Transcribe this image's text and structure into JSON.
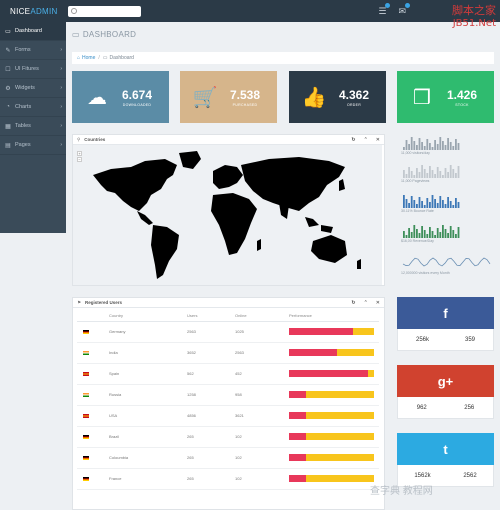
{
  "brand": {
    "nice": "NICE",
    "admin": "ADMIN"
  },
  "search": {
    "placeholder": ""
  },
  "watermark": {
    "line1": "脚本之家",
    "line2": "JB51.Net",
    "line3": "查字典 教程网"
  },
  "sidebar": {
    "items": [
      {
        "label": "Dashboard",
        "icon": "laptop-icon"
      },
      {
        "label": "Forms",
        "icon": "edit-icon"
      },
      {
        "label": "UI Fitures",
        "icon": "document-icon"
      },
      {
        "label": "Widgets",
        "icon": "settings-icon"
      },
      {
        "label": "Charts",
        "icon": "pie-chart-icon"
      },
      {
        "label": "Tables",
        "icon": "table-icon"
      },
      {
        "label": "Pages",
        "icon": "pages-icon"
      }
    ]
  },
  "page": {
    "title": "DASHBOARD"
  },
  "breadcrumb": {
    "home": "Home",
    "current": "Dashboard"
  },
  "tiles": [
    {
      "value": "6.674",
      "label": "DOWNLOADED",
      "color": "#5b8ca6",
      "icon": "cloud-download-icon"
    },
    {
      "value": "7.538",
      "label": "PURCHASED",
      "color": "#d6b58b",
      "icon": "cart-icon"
    },
    {
      "value": "4.362",
      "label": "ORDER",
      "color": "#2b3a47",
      "icon": "thumbs-up-icon"
    },
    {
      "value": "1.426",
      "label": "STOCK",
      "color": "#2fbb6f",
      "icon": "cubes-icon"
    }
  ],
  "countries_panel": {
    "title": "Countries"
  },
  "users_panel": {
    "title": "Registered Users",
    "columns": [
      "Country",
      "Users",
      "Online",
      "Performance"
    ],
    "rows": [
      {
        "country": "Germany",
        "users": "2563",
        "online": "1025",
        "perf": 0.75,
        "flag": "de"
      },
      {
        "country": "India",
        "users": "3652",
        "online": "2563",
        "perf": 0.57,
        "flag": "in"
      },
      {
        "country": "Spain",
        "users": "562",
        "online": "452",
        "perf": 0.93,
        "flag": "es"
      },
      {
        "country": "Russia",
        "users": "1258",
        "online": "958",
        "perf": 0.2,
        "flag": "in"
      },
      {
        "country": "USA",
        "users": "4856",
        "online": "3621",
        "perf": 0.2,
        "flag": "es"
      },
      {
        "country": "Brazil",
        "users": "265",
        "online": "102",
        "perf": 0.2,
        "flag": "de"
      },
      {
        "country": "Coloumbia",
        "users": "265",
        "online": "102",
        "perf": 0.2,
        "flag": "de"
      },
      {
        "country": "France",
        "users": "265",
        "online": "102",
        "perf": 0.2,
        "flag": "de"
      }
    ]
  },
  "sparks": [
    {
      "label": "11,000 visitors/day",
      "color": "#9aa5af",
      "kind": "bars"
    },
    {
      "label": "11,000 Pageviews",
      "color": "#c2c8ce",
      "kind": "bars"
    },
    {
      "label": "30.11% Bounce Rate",
      "color": "#3d78b7",
      "kind": "bars"
    },
    {
      "label": "$16,00 Revenue/Day",
      "color": "#3e8f5a",
      "kind": "bars"
    },
    {
      "label": "12,000000 visitors every Month",
      "color": "#6a8fb3",
      "kind": "line"
    }
  ],
  "social": [
    {
      "icon": "facebook-icon",
      "glyph": "f",
      "color": "#3b5a98",
      "a": "256k",
      "b": "359"
    },
    {
      "icon": "google-plus-icon",
      "glyph": "g+",
      "color": "#d0422f",
      "a": "962",
      "b": "256"
    },
    {
      "icon": "twitter-icon",
      "glyph": "t",
      "color": "#2caae1",
      "a": "1562k",
      "b": "2562"
    }
  ],
  "flags": {
    "de": [
      "#000000",
      "#dd0000",
      "#ffce00"
    ],
    "in": [
      "#ff9933",
      "#ffffff",
      "#138808"
    ],
    "es": [
      "#c60b1e",
      "#ffc400",
      "#c60b1e"
    ]
  }
}
